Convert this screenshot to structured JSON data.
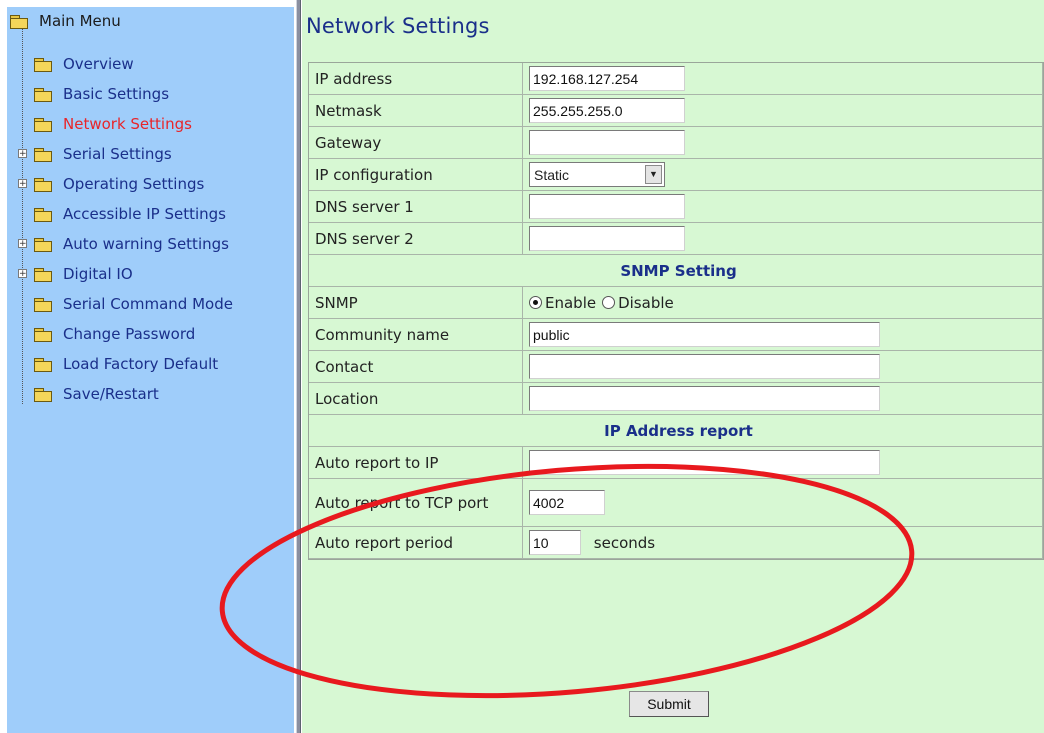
{
  "sidebar": {
    "root_label": "Main Menu",
    "items": [
      {
        "label": "Overview",
        "expandable": false,
        "active": false
      },
      {
        "label": "Basic Settings",
        "expandable": false,
        "active": false
      },
      {
        "label": "Network Settings",
        "expandable": false,
        "active": true
      },
      {
        "label": "Serial Settings",
        "expandable": true,
        "active": false
      },
      {
        "label": "Operating Settings",
        "expandable": true,
        "active": false
      },
      {
        "label": "Accessible IP Settings",
        "expandable": false,
        "active": false
      },
      {
        "label": "Auto warning Settings",
        "expandable": true,
        "active": false
      },
      {
        "label": "Digital IO",
        "expandable": true,
        "active": false
      },
      {
        "label": "Serial Command Mode",
        "expandable": false,
        "active": false
      },
      {
        "label": "Change Password",
        "expandable": false,
        "active": false
      },
      {
        "label": "Load Factory Default",
        "expandable": false,
        "active": false
      },
      {
        "label": "Save/Restart",
        "expandable": false,
        "active": false
      }
    ]
  },
  "page": {
    "title": "Network Settings"
  },
  "form": {
    "ip_address": {
      "label": "IP address",
      "value": "192.168.127.254"
    },
    "netmask": {
      "label": "Netmask",
      "value": "255.255.255.0"
    },
    "gateway": {
      "label": "Gateway",
      "value": ""
    },
    "ip_config": {
      "label": "IP configuration",
      "value": "Static"
    },
    "dns1": {
      "label": "DNS server 1",
      "value": ""
    },
    "dns2": {
      "label": "DNS server 2",
      "value": ""
    },
    "snmp_section": "SNMP Setting",
    "snmp": {
      "label": "SNMP",
      "enable_label": "Enable",
      "disable_label": "Disable",
      "selected": "Enable"
    },
    "community": {
      "label": "Community name",
      "value": "public"
    },
    "contact": {
      "label": "Contact",
      "value": ""
    },
    "location": {
      "label": "Location",
      "value": ""
    },
    "ip_report_section": "IP Address report",
    "auto_ip": {
      "label": "Auto report to IP",
      "value": ""
    },
    "auto_port": {
      "label": "Auto report to TCP port",
      "value": "4002"
    },
    "auto_period": {
      "label": "Auto report period",
      "value": "10",
      "unit": "seconds"
    }
  },
  "submit_label": "Submit",
  "colors": {
    "sidebar_bg": "#9fcdfa",
    "main_bg": "#d7f8d3",
    "link": "#1a2f8a",
    "active_link": "#e8252a",
    "annotation": "#e8191e"
  },
  "icons": {
    "folder": "folder-icon",
    "expander": "plus-box-icon",
    "dropdown": "chevron-down-icon"
  }
}
